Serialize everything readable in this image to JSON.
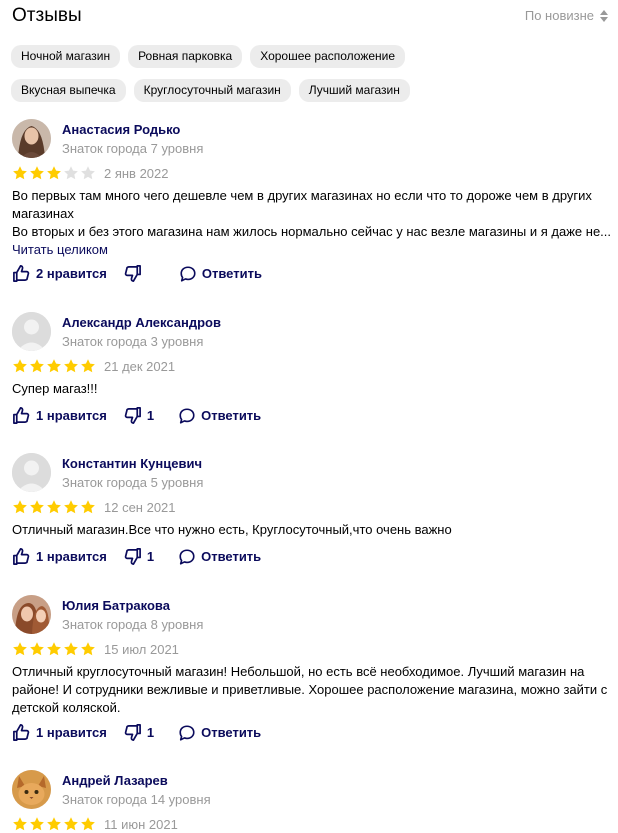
{
  "header": {
    "title": "Отзывы",
    "sort_label": "По новизне"
  },
  "chips": [
    "Ночной магазин",
    "Ровная парковка",
    "Хорошее расположение",
    "Вкусная выпечка",
    "Круглосуточный магазин",
    "Лучший магазин"
  ],
  "colors": {
    "star_filled": "#ffcc00",
    "star_empty": "#e0e0e0",
    "link": "#0b0b5c",
    "muted": "#999999"
  },
  "reviews": [
    {
      "author": "Анастасия Родько",
      "level": "Знаток города 7 уровня",
      "rating": 3,
      "date": "2 янв 2022",
      "text": "Во первых там много чего дешевле чем в других магазинах но если что то дороже чем в других магазинах\nВо вторых и без этого магазина нам жилось нормально сейчас у нас везле магазины и я даже не...",
      "read_more": "Читать целиком",
      "likes": "2 нравится",
      "dislikes": "",
      "reply": "Ответить",
      "avatar_icon": "user-photo-icon"
    },
    {
      "author": "Александр Александров",
      "level": "Знаток города 3 уровня",
      "rating": 5,
      "date": "21 дек 2021",
      "text": "Супер магаз!!!",
      "read_more": "",
      "likes": "1 нравится",
      "dislikes": "1",
      "reply": "Ответить",
      "avatar_icon": "default-avatar-icon"
    },
    {
      "author": "Константин Кунцевич",
      "level": "Знаток города 5 уровня",
      "rating": 5,
      "date": "12 сен 2021",
      "text": "Отличный магазин.Все что нужно есть, Круглосуточный,что очень важно",
      "read_more": "",
      "likes": "1 нравится",
      "dislikes": "1",
      "reply": "Ответить",
      "avatar_icon": "default-avatar-icon"
    },
    {
      "author": "Юлия Батракова",
      "level": "Знаток города 8 уровня",
      "rating": 5,
      "date": "15 июл 2021",
      "text": "Отличный круглосуточный магазин! Небольшой, но есть всё необходимое. Лучший магазин на районе! И сотрудники вежливые и приветливые. Хорошее расположение магазина, можно зайти с детской коляской.",
      "read_more": "",
      "likes": "1 нравится",
      "dislikes": "1",
      "reply": "Ответить",
      "avatar_icon": "user-photo-icon"
    },
    {
      "author": "Андрей Лазарев",
      "level": "Знаток города 14 уровня",
      "rating": 5,
      "date": "11 июн 2021",
      "text": "",
      "read_more": "",
      "likes": "",
      "dislikes": "",
      "reply": "",
      "avatar_icon": "cat-photo-icon"
    }
  ]
}
